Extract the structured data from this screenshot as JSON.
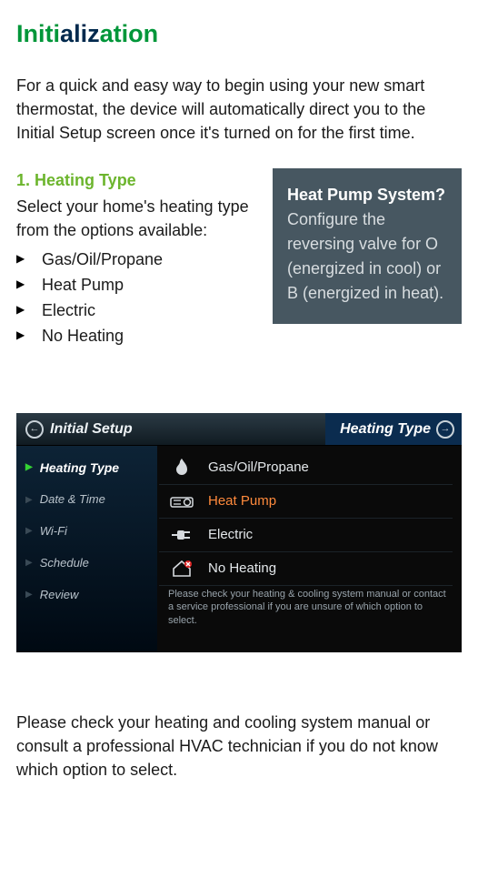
{
  "title": {
    "word": "Initialization",
    "green_chars": [
      0,
      1,
      2,
      3,
      4,
      9,
      10,
      11,
      12,
      13
    ],
    "blue_chars": [
      5,
      6,
      7,
      8
    ]
  },
  "intro": "For a quick and easy way to begin using your new smart thermostat, the device will automatically direct you to the Initial Setup screen once it's turned on for the first time.",
  "step": {
    "number_label": "1.  Heating Type",
    "desc": "Select your home's heating type from the options available:",
    "bullets": [
      "Gas/Oil/Propane",
      "Heat Pump",
      "Electric",
      "No Heating"
    ]
  },
  "callout": {
    "title": "Heat Pump System?",
    "body": "Configure the reversing valve for O (energized in cool) or B (energized in heat)."
  },
  "device": {
    "back_label": "Initial Setup",
    "right_title": "Heating Type",
    "nav": [
      {
        "label": "Heating Type",
        "active": true
      },
      {
        "label": "Date & Time",
        "active": false
      },
      {
        "label": "Wi-Fi",
        "active": false
      },
      {
        "label": "Schedule",
        "active": false
      },
      {
        "label": "Review",
        "active": false
      }
    ],
    "options": [
      {
        "label": "Gas/Oil/Propane",
        "icon": "flame-icon",
        "selected": false
      },
      {
        "label": "Heat Pump",
        "icon": "heat-pump-icon",
        "selected": true
      },
      {
        "label": "Electric",
        "icon": "plug-icon",
        "selected": false
      },
      {
        "label": "No Heating",
        "icon": "house-x-icon",
        "selected": false
      }
    ],
    "hint": "Please check your heating & cooling system manual or contact a service professional if you are unsure of which option to select."
  },
  "footer_note": "Please check your heating and cooling system manual or consult a professional HVAC technician if you do not know which option to select."
}
